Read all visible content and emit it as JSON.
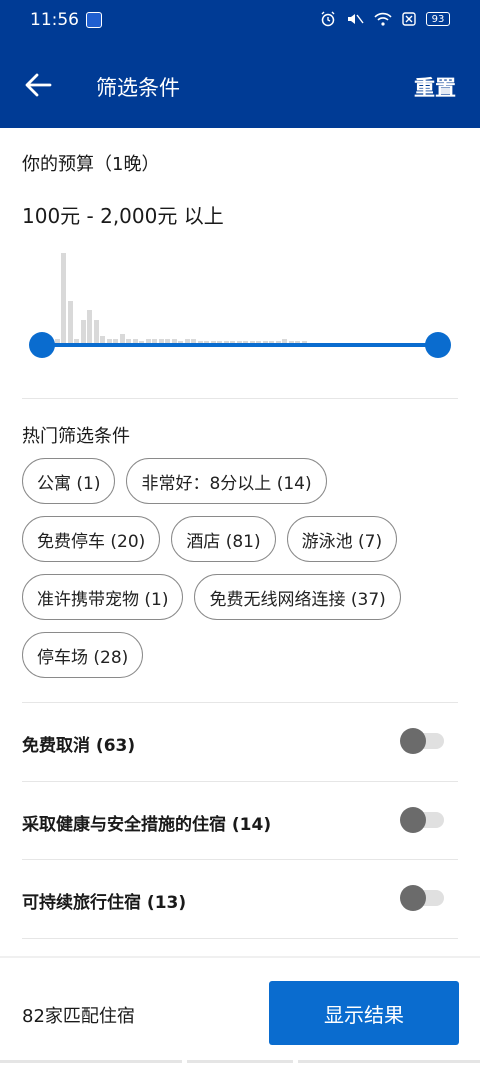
{
  "status": {
    "time": "11:56",
    "battery": "93"
  },
  "toolbar": {
    "title": "筛选条件",
    "reset_label": "重置"
  },
  "budget": {
    "title": "你的预算（1晚）",
    "range": "100元 - 2,000元 以上",
    "min_fraction": 0,
    "max_fraction": 1,
    "histogram": [
      0.05,
      0.05,
      0.95,
      0.45,
      0.05,
      0.25,
      0.35,
      0.25,
      0.08,
      0.05,
      0.05,
      0.1,
      0.05,
      0.05,
      0.02,
      0.05,
      0.05,
      0.05,
      0.05,
      0.05,
      0.02,
      0.05,
      0.05,
      0.02,
      0.02,
      0.02,
      0.02,
      0.02,
      0.02,
      0.02,
      0.02,
      0.02,
      0.02,
      0.02,
      0.02,
      0.02,
      0.05,
      0.02,
      0.02,
      0.02
    ]
  },
  "hot_filters": {
    "title": "热门筛选条件",
    "chips": [
      "公寓 (1)",
      "非常好：8分以上 (14)",
      "免费停车 (20)",
      "酒店 (81)",
      "游泳池 (7)",
      "准许携带宠物 (1)",
      "免费无线网络连接 (37)",
      "停车场 (28)"
    ]
  },
  "toggles": [
    {
      "label": "免费取消 (63)",
      "on": false
    },
    {
      "label": "采取健康与安全措施的住宿 (14)",
      "on": false
    },
    {
      "label": "可持续旅行住宿 (13)",
      "on": false
    }
  ],
  "footer": {
    "match_count": "82家匹配住宿",
    "show_results_label": "显示结果"
  },
  "colors": {
    "brand": "#003b95",
    "accent": "#0a6ccf"
  }
}
